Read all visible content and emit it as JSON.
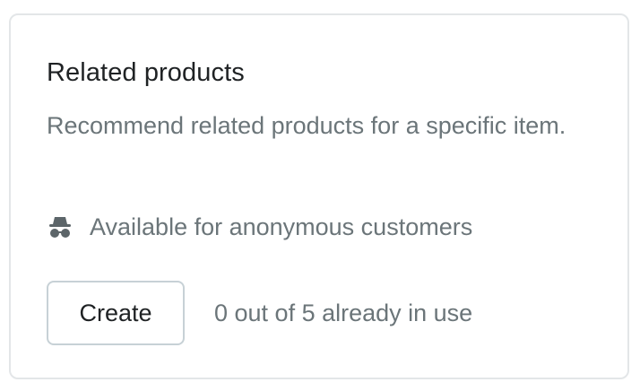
{
  "card": {
    "title": "Related products",
    "description": "Recommend related products for a specific item.",
    "feature": {
      "icon": "incognito-icon",
      "label": "Available for anonymous customers"
    },
    "create_button_label": "Create",
    "usage_text": "0 out of 5 already in use"
  },
  "colors": {
    "title": "#1f2224",
    "secondary_text": "#6b7579",
    "icon": "#5c6569",
    "border": "#e3e6e8",
    "button_border": "#c7d1d6"
  }
}
